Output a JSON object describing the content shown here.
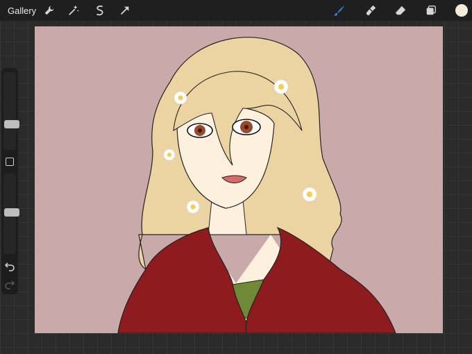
{
  "toolbar": {
    "gallery_label": "Gallery",
    "left_tools": [
      "wrench-icon",
      "magic-wand-icon",
      "selection-icon",
      "transform-arrow-icon"
    ],
    "right_tools": [
      "brush-icon",
      "smudge-icon",
      "eraser-icon",
      "layers-icon",
      "color-swatch"
    ],
    "active_tool": "brush",
    "active_color": "#1e88e5",
    "current_color": "#f6ead8"
  },
  "sidebar": {
    "brush_size": 0.31,
    "opacity": 0.52,
    "controls": [
      "brush-size-slider",
      "modify-button",
      "opacity-slider",
      "undo-button",
      "redo-button"
    ]
  },
  "canvas": {
    "background_color": "#c9a9a9",
    "hair_color": "#ecd3a2",
    "skin_color": "#fdf0dc",
    "eye_color": "#9a4a2a",
    "jacket_color": "#8e1b1d",
    "shirt_color": "#6f8a36"
  }
}
